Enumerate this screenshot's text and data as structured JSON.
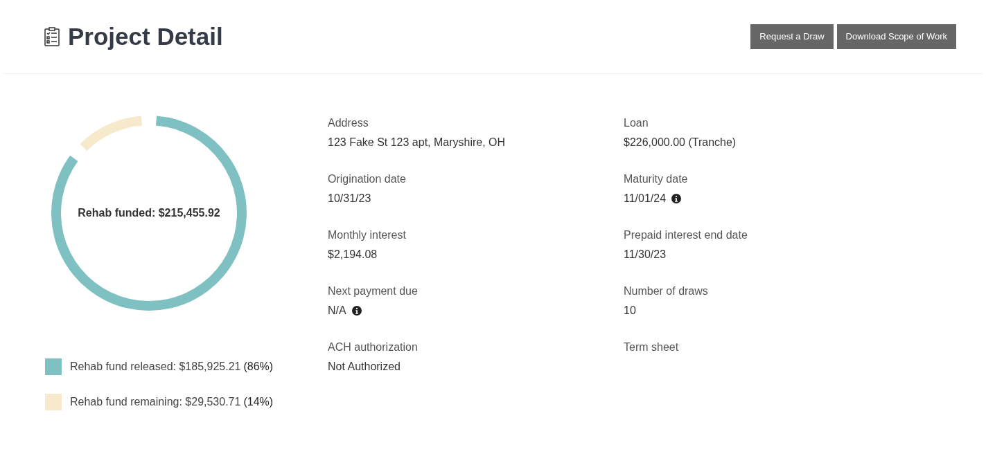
{
  "header": {
    "title": "Project Detail",
    "buttons": [
      "Request a Draw",
      "Download Scope of Work"
    ]
  },
  "funding": {
    "center_label": "Rehab funded: $215,455.92",
    "chart_data": {
      "type": "donut",
      "categories": [
        "Rehab fund released: $185,925.21",
        "Rehab fund remaining: $29,530.71"
      ],
      "values": [
        185925.21,
        29530.71
      ]
    },
    "legend": [
      {
        "percent": "(86%)",
        "color": "#7fc1c2"
      },
      {
        "percent": "(14%)",
        "color": "#f7e9cc"
      }
    ]
  },
  "details": [
    [
      {
        "label": "Address",
        "value": "123 Fake St 123 apt, Maryshire, OH",
        "info": false
      },
      {
        "label": "Origination date",
        "value": "10/31/23",
        "info": false
      },
      {
        "label": "Monthly interest",
        "value": "$2,194.08",
        "info": false
      },
      {
        "label": "Next payment due",
        "value": "N/A",
        "info": true
      },
      {
        "label": "ACH authorization",
        "value": "Not Authorized",
        "info": false
      }
    ],
    [
      {
        "label": "Loan",
        "value": "$226,000.00 (Tranche)",
        "info": false
      },
      {
        "label": "Maturity date",
        "value": "11/01/24",
        "info": true
      },
      {
        "label": "Prepaid interest end date",
        "value": "11/30/23",
        "info": false
      },
      {
        "label": "Number of draws",
        "value": "10",
        "info": false
      },
      {
        "label": "Term sheet"
      }
    ]
  ]
}
